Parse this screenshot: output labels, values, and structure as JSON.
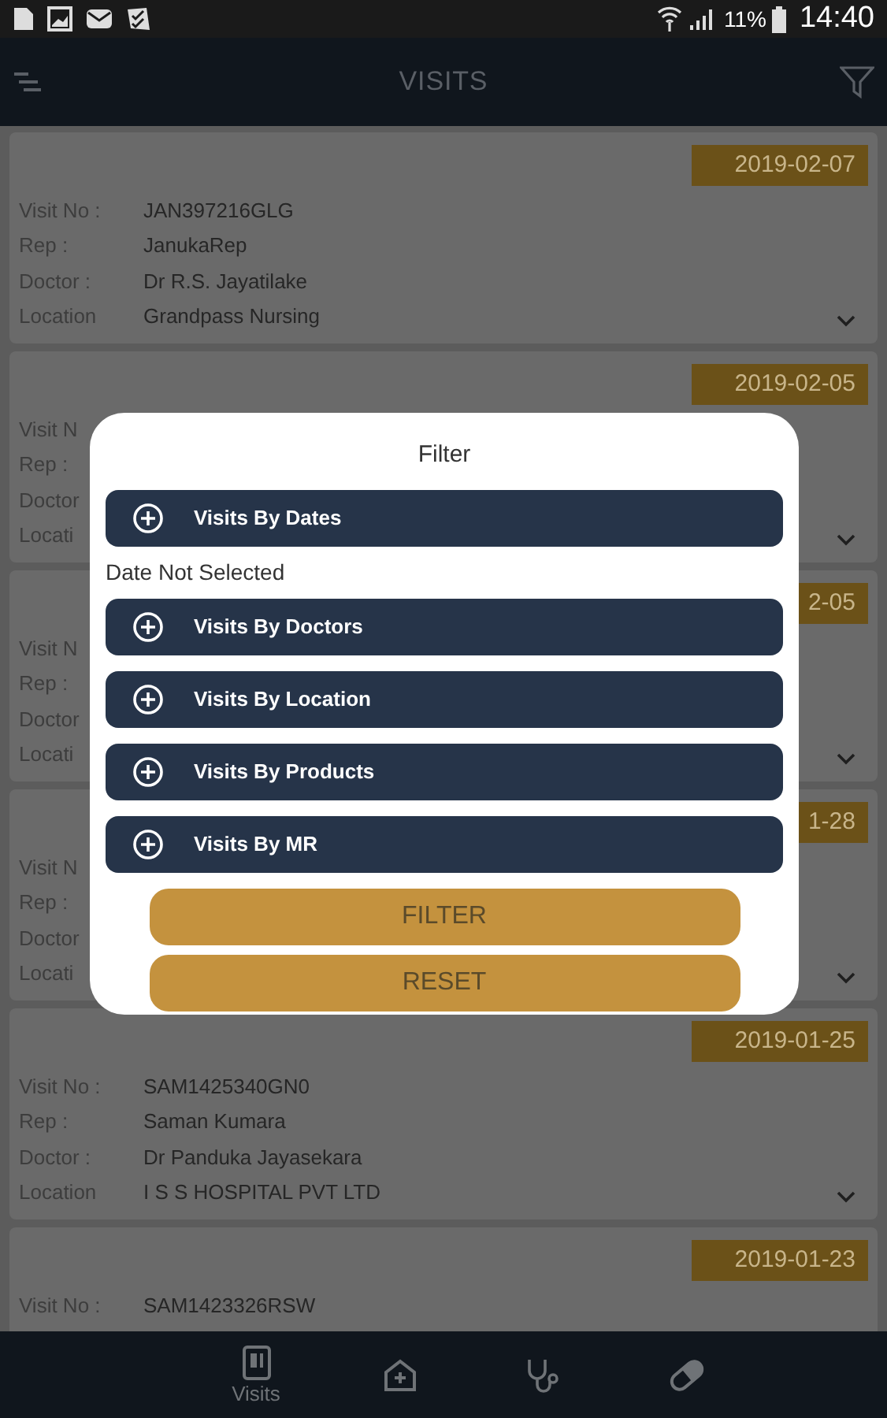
{
  "status_bar": {
    "battery": "11%",
    "time": "14:40"
  },
  "header": {
    "title": "VISITS"
  },
  "visits": [
    {
      "date": "2019-02-07",
      "rows": [
        {
          "label": "Visit No :",
          "value": "JAN397216GLG"
        },
        {
          "label": "Rep :",
          "value": "JanukaRep"
        },
        {
          "label": "Doctor :",
          "value": "Dr R.S. Jayatilake"
        },
        {
          "label": "Location",
          "value": "Grandpass Nursing"
        }
      ]
    },
    {
      "date": "2019-02-05",
      "rows": [
        {
          "label": "Visit N"
        },
        {
          "label": "Rep :"
        },
        {
          "label": "Doctor"
        },
        {
          "label": "Locati"
        }
      ]
    },
    {
      "date": "2-05",
      "rows": [
        {
          "label": "Visit N"
        },
        {
          "label": "Rep :"
        },
        {
          "label": "Doctor"
        },
        {
          "label": "Locati"
        }
      ]
    },
    {
      "date": "1-28",
      "rows": [
        {
          "label": "Visit N"
        },
        {
          "label": "Rep :"
        },
        {
          "label": "Doctor"
        },
        {
          "label": "Locati"
        }
      ]
    },
    {
      "date": "2019-01-25",
      "rows": [
        {
          "label": "Visit No :",
          "value": "SAM1425340GN0"
        },
        {
          "label": "Rep :",
          "value": "Saman Kumara"
        },
        {
          "label": "Doctor :",
          "value": "Dr Panduka Jayasekara"
        },
        {
          "label": "Location",
          "value": "I S S HOSPITAL PVT LTD"
        }
      ]
    },
    {
      "date": "2019-01-23",
      "rows": [
        {
          "label": "Visit No :",
          "value": "SAM1423326RSW"
        }
      ]
    }
  ],
  "filter_dialog": {
    "title": "Filter",
    "items": [
      {
        "kind": "section",
        "label": "Visits By Dates"
      },
      {
        "kind": "note",
        "label": "Date Not Selected"
      },
      {
        "kind": "section",
        "label": "Visits By Doctors"
      },
      {
        "kind": "section",
        "label": "Visits By Location"
      },
      {
        "kind": "section",
        "label": "Visits By Products"
      },
      {
        "kind": "section",
        "label": "Visits By MR"
      }
    ],
    "buttons": [
      "FILTER",
      "RESET"
    ]
  },
  "bottom_nav": [
    {
      "kind": "visits",
      "label": "Visits"
    },
    {
      "kind": "hospital"
    },
    {
      "kind": "stethoscope"
    },
    {
      "kind": "pill"
    }
  ]
}
